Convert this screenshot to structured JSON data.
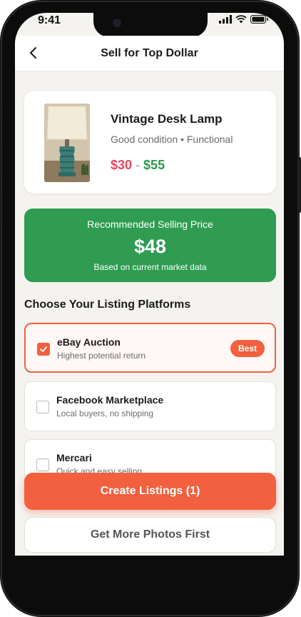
{
  "status_bar": {
    "time": "9:41"
  },
  "header": {
    "title": "Sell for Top Dollar"
  },
  "product": {
    "name": "Vintage Desk Lamp",
    "condition": "Good condition • Functional",
    "price_low": "$30",
    "price_separator": "-",
    "price_high": "$55"
  },
  "recommendation": {
    "label": "Recommended Selling Price",
    "price": "$48",
    "subtitle": "Based on current market data"
  },
  "platforms_section": {
    "title": "Choose Your Listing Platforms"
  },
  "platforms": [
    {
      "name": "eBay Auction",
      "description": "Highest potential return",
      "checked": true,
      "badge": "Best"
    },
    {
      "name": "Facebook Marketplace",
      "description": "Local buyers, no shipping",
      "checked": false
    },
    {
      "name": "Mercari",
      "description": "Quick and easy selling",
      "checked": false
    }
  ],
  "actions": {
    "primary_label": "Create Listings (1)",
    "secondary_label": "Get More Photos First"
  },
  "colors": {
    "accent": "#f2603f",
    "recommend_green": "#2f9c52",
    "price_low": "#e8465d",
    "price_high": "#2e9a4e"
  }
}
